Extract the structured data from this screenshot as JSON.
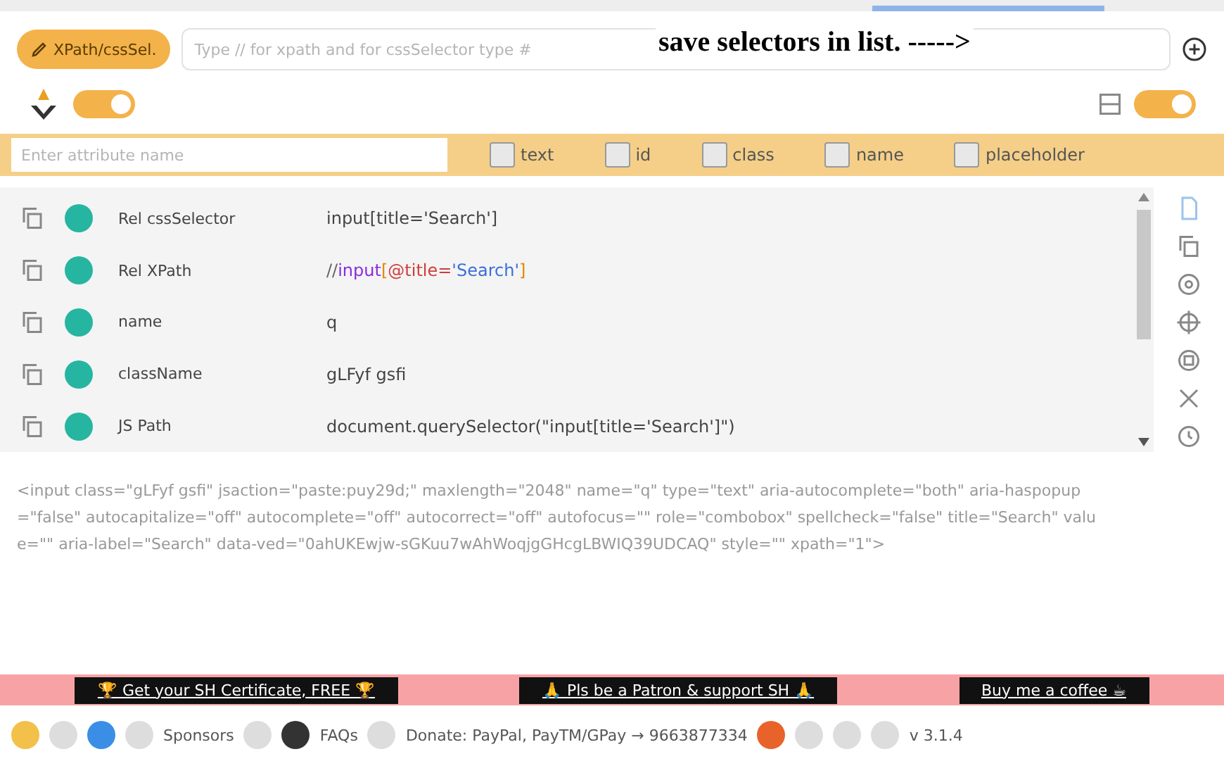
{
  "top_tab": {
    "selected": true
  },
  "query": {
    "mode_button": "XPath/cssSel.",
    "placeholder": "Type // for xpath and for cssSelector type #"
  },
  "annotation": "save selectors in list. ----->",
  "toggles": [
    {
      "on": true
    },
    {
      "on": true
    }
  ],
  "attributes": {
    "placeholder": "Enter attribute name",
    "options": [
      {
        "label": "text",
        "checked": false
      },
      {
        "label": "id",
        "checked": false
      },
      {
        "label": "class",
        "checked": false
      },
      {
        "label": "name",
        "checked": false
      },
      {
        "label": "placeholder",
        "checked": false
      }
    ]
  },
  "selectors": [
    {
      "name": "Rel cssSelector",
      "tokens": [
        {
          "text": "input[title='Search']",
          "color": "#444444"
        }
      ]
    },
    {
      "name": "Rel XPath",
      "tokens": [
        {
          "text": "//",
          "color": "#666666"
        },
        {
          "text": "input",
          "color": "#8a2be2"
        },
        {
          "text": "[",
          "color": "#e08a00"
        },
        {
          "text": "@title=",
          "color": "#d23c3c"
        },
        {
          "text": "'Search'",
          "color": "#3a6fd8"
        },
        {
          "text": "]",
          "color": "#e08a00"
        }
      ]
    },
    {
      "name": "name",
      "tokens": [
        {
          "text": "q",
          "color": "#444444"
        }
      ]
    },
    {
      "name": "className",
      "tokens": [
        {
          "text": "gLFyf gsfi",
          "color": "#444444"
        }
      ]
    },
    {
      "name": "JS Path",
      "tokens": [
        {
          "text": "document.querySelector(\"input[title='Search']\")",
          "color": "#444444"
        }
      ]
    }
  ],
  "outer_html": "<input class=\"gLFyf gsfi\" jsaction=\"paste:puy29d;\" maxlength=\"2048\" name=\"q\" type=\"text\" aria-autocomplete=\"both\" aria-haspopup=\"false\" autocapitalize=\"off\" autocomplete=\"off\" autocorrect=\"off\" autofocus=\"\" role=\"combobox\" spellcheck=\"false\" title=\"Search\" value=\"\" aria-label=\"Search\" data-ved=\"0ahUKEwjw-sGKuu7wAhWoqjgGHcgLBWIQ39UDCAQ\" style=\"\" xpath=\"1\">",
  "banners": [
    "🏆 Get your SH Certificate, FREE 🏆",
    "🙏 Pls be a Patron & support SH 🙏",
    "Buy me a coffee ☕"
  ],
  "footer": {
    "sponsors": "Sponsors",
    "faqs": "FAQs",
    "donate": "Donate: PayPal, PayTM/GPay → 9663877334",
    "version": "v 3.1.4"
  }
}
